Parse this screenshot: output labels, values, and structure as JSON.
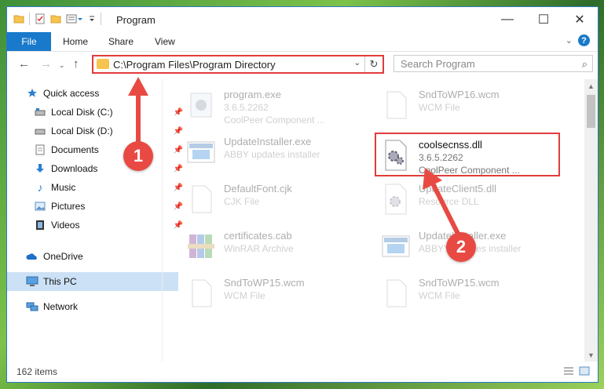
{
  "window": {
    "title": "Program"
  },
  "ribbon": {
    "tabs": [
      "File",
      "Home",
      "Share",
      "View"
    ],
    "help": "?"
  },
  "address": {
    "path": "C:\\Program Files\\Program Directory"
  },
  "search": {
    "placeholder": "Search Program"
  },
  "sidebar": {
    "items": [
      {
        "label": "Quick access",
        "icon": "star-icon",
        "pinned": false
      },
      {
        "label": "Local Disk (C:)",
        "icon": "drive-icon",
        "pinned": true
      },
      {
        "label": "Local Disk (D:)",
        "icon": "drive-icon",
        "pinned": true
      },
      {
        "label": "Documents",
        "icon": "documents-icon",
        "pinned": true
      },
      {
        "label": "Downloads",
        "icon": "downloads-icon",
        "pinned": true
      },
      {
        "label": "Music",
        "icon": "music-icon",
        "pinned": true
      },
      {
        "label": "Pictures",
        "icon": "pictures-icon",
        "pinned": true
      },
      {
        "label": "Videos",
        "icon": "videos-icon",
        "pinned": true
      },
      {
        "label": "OneDrive",
        "icon": "onedrive-icon",
        "pinned": false
      },
      {
        "label": "This PC",
        "icon": "this-pc-icon",
        "pinned": false
      },
      {
        "label": "Network",
        "icon": "network-icon",
        "pinned": false
      }
    ]
  },
  "files": [
    {
      "name": "program.exe",
      "line2": "3.6.5.2262",
      "line3": "CoolPeer Component ...",
      "icon": "exe-icon"
    },
    {
      "name": "SndToWP16.wcm",
      "line2": "WCM File",
      "line3": "",
      "icon": "file-icon"
    },
    {
      "name": "UpdateInstaller.exe",
      "line2": "ABBY updates installer",
      "line3": "",
      "icon": "installer-icon"
    },
    {
      "name": "coolsecnss.dll",
      "line2": "3.6.5.2262",
      "line3": "CoolPeer Component ...",
      "icon": "dll-gear-icon"
    },
    {
      "name": "DefaultFont.cjk",
      "line2": "CJK File",
      "line3": "",
      "icon": "file-icon"
    },
    {
      "name": "UpdateClient5.dll",
      "line2": "Resource DLL",
      "line3": "",
      "icon": "dll-gear-icon"
    },
    {
      "name": "certificates.cab",
      "line2": "WinRAR Archive",
      "line3": "",
      "icon": "archive-icon"
    },
    {
      "name": "UpdateInstaller.exe",
      "line2": "ABBYY updates installer",
      "line3": "",
      "icon": "installer-icon"
    },
    {
      "name": "SndToWP15.wcm",
      "line2": "WCM File",
      "line3": "",
      "icon": "file-icon"
    },
    {
      "name": "SndToWP15.wcm",
      "line2": "WCM File",
      "line3": "",
      "icon": "file-icon"
    }
  ],
  "annotations": {
    "step1": "1",
    "step2": "2"
  },
  "status": {
    "count": "162 items"
  },
  "colors": {
    "accent": "#1979ca",
    "highlight": "#e03c3c",
    "selected": "#cce1f5"
  }
}
